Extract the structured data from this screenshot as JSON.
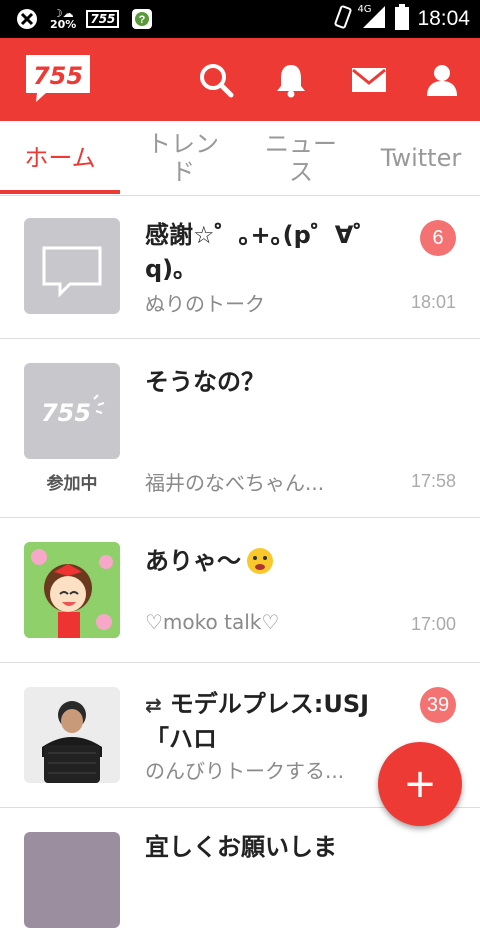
{
  "status_bar": {
    "weather_temp": "20%",
    "app_label": "755",
    "network": "4G",
    "time": "18:04"
  },
  "header": {
    "logo_text": "755",
    "icons": [
      "search-icon",
      "bell-icon",
      "mail-icon",
      "user-icon"
    ]
  },
  "tabs": [
    {
      "label": "ホーム",
      "active": true
    },
    {
      "label": "トレンド",
      "active": false
    },
    {
      "label": "ニュース",
      "active": false
    },
    {
      "label": "Twitter",
      "active": false
    }
  ],
  "talks": [
    {
      "title": "感謝☆゜｡+｡(p゜∀゜q)｡",
      "subtitle": "ぬりのトーク",
      "time": "18:01",
      "badge": "6",
      "joined": ""
    },
    {
      "title": "そうなの？",
      "subtitle": "福井のなべちゃん...",
      "time": "17:58",
      "badge": "",
      "joined": "参加中",
      "thumb_text": "755"
    },
    {
      "title": "ありゃ〜",
      "subtitle": "♡moko talk♡",
      "time": "17:00",
      "badge": "",
      "joined": ""
    },
    {
      "title": "モデルプレス:USJ「ハロ",
      "subtitle": "のんびりトークする...",
      "time": "",
      "badge": "39",
      "joined": ""
    },
    {
      "title": "宜しくお願いしま",
      "subtitle": "",
      "time": "",
      "badge": "",
      "joined": ""
    }
  ],
  "fab_label": "+",
  "colors": {
    "accent": "#ee3a35",
    "badge": "#f47272"
  }
}
